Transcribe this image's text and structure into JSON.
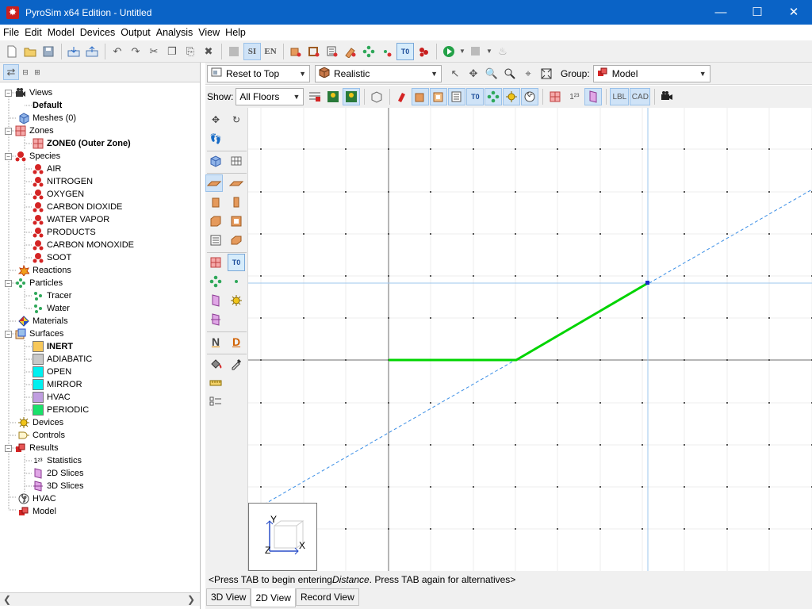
{
  "window": {
    "title": "PyroSim x64 Edition - Untitled",
    "app_icon_letter": "✸"
  },
  "menu": [
    "File",
    "Edit",
    "Model",
    "Devices",
    "Output",
    "Analysis",
    "View",
    "Help"
  ],
  "toolbar": {
    "si_label": "SI",
    "en_label": "EN"
  },
  "view_header": {
    "reset_label": "Reset to Top",
    "render_mode": "Realistic",
    "group_label": "Group:",
    "group_value": "Model",
    "show_label": "Show:",
    "floors_value": "All Floors",
    "lbl_button": "LBL",
    "cad_button": "CAD",
    "superscript_label": "1²³"
  },
  "side_tools": {
    "n_label": "N",
    "d_label": "D",
    "t0_label": "T0"
  },
  "tree": {
    "views": "Views",
    "default_view": "Default",
    "meshes": "Meshes (0)",
    "zones": "Zones",
    "zone0": "ZONE0 (Outer Zone)",
    "species": "Species",
    "species_items": [
      "AIR",
      "NITROGEN",
      "OXYGEN",
      "CARBON DIOXIDE",
      "WATER VAPOR",
      "PRODUCTS",
      "CARBON MONOXIDE",
      "SOOT"
    ],
    "reactions": "Reactions",
    "particles": "Particles",
    "particle_items": [
      "Tracer",
      "Water"
    ],
    "materials": "Materials",
    "surfaces": "Surfaces",
    "surface_items": [
      {
        "label": "INERT",
        "color": "#f7c85a",
        "bold": true
      },
      {
        "label": "ADIABATIC",
        "color": "#c8c8c8",
        "bold": false
      },
      {
        "label": "OPEN",
        "color": "#00f0f0",
        "bold": false
      },
      {
        "label": "MIRROR",
        "color": "#00f0f0",
        "bold": false
      },
      {
        "label": "HVAC",
        "color": "#c09ee0",
        "bold": false
      },
      {
        "label": "PERIODIC",
        "color": "#19e16a",
        "bold": false
      }
    ],
    "devices": "Devices",
    "controls": "Controls",
    "results": "Results",
    "result_items": [
      "Statistics",
      "2D Slices",
      "3D Slices"
    ],
    "hvac": "HVAC",
    "model": "Model"
  },
  "viewport": {
    "axis_y": "Y",
    "axis_z": "Z",
    "axis_x": "X",
    "line_color": "#00d400",
    "guide_color": "#3a8ee6"
  },
  "status": {
    "prefix": "<Press TAB to begin entering ",
    "emph": "Distance",
    "suffix": ". Press TAB again for alternatives>"
  },
  "view_tabs": [
    "3D View",
    "2D View",
    "Record View"
  ],
  "active_tab": "2D View"
}
